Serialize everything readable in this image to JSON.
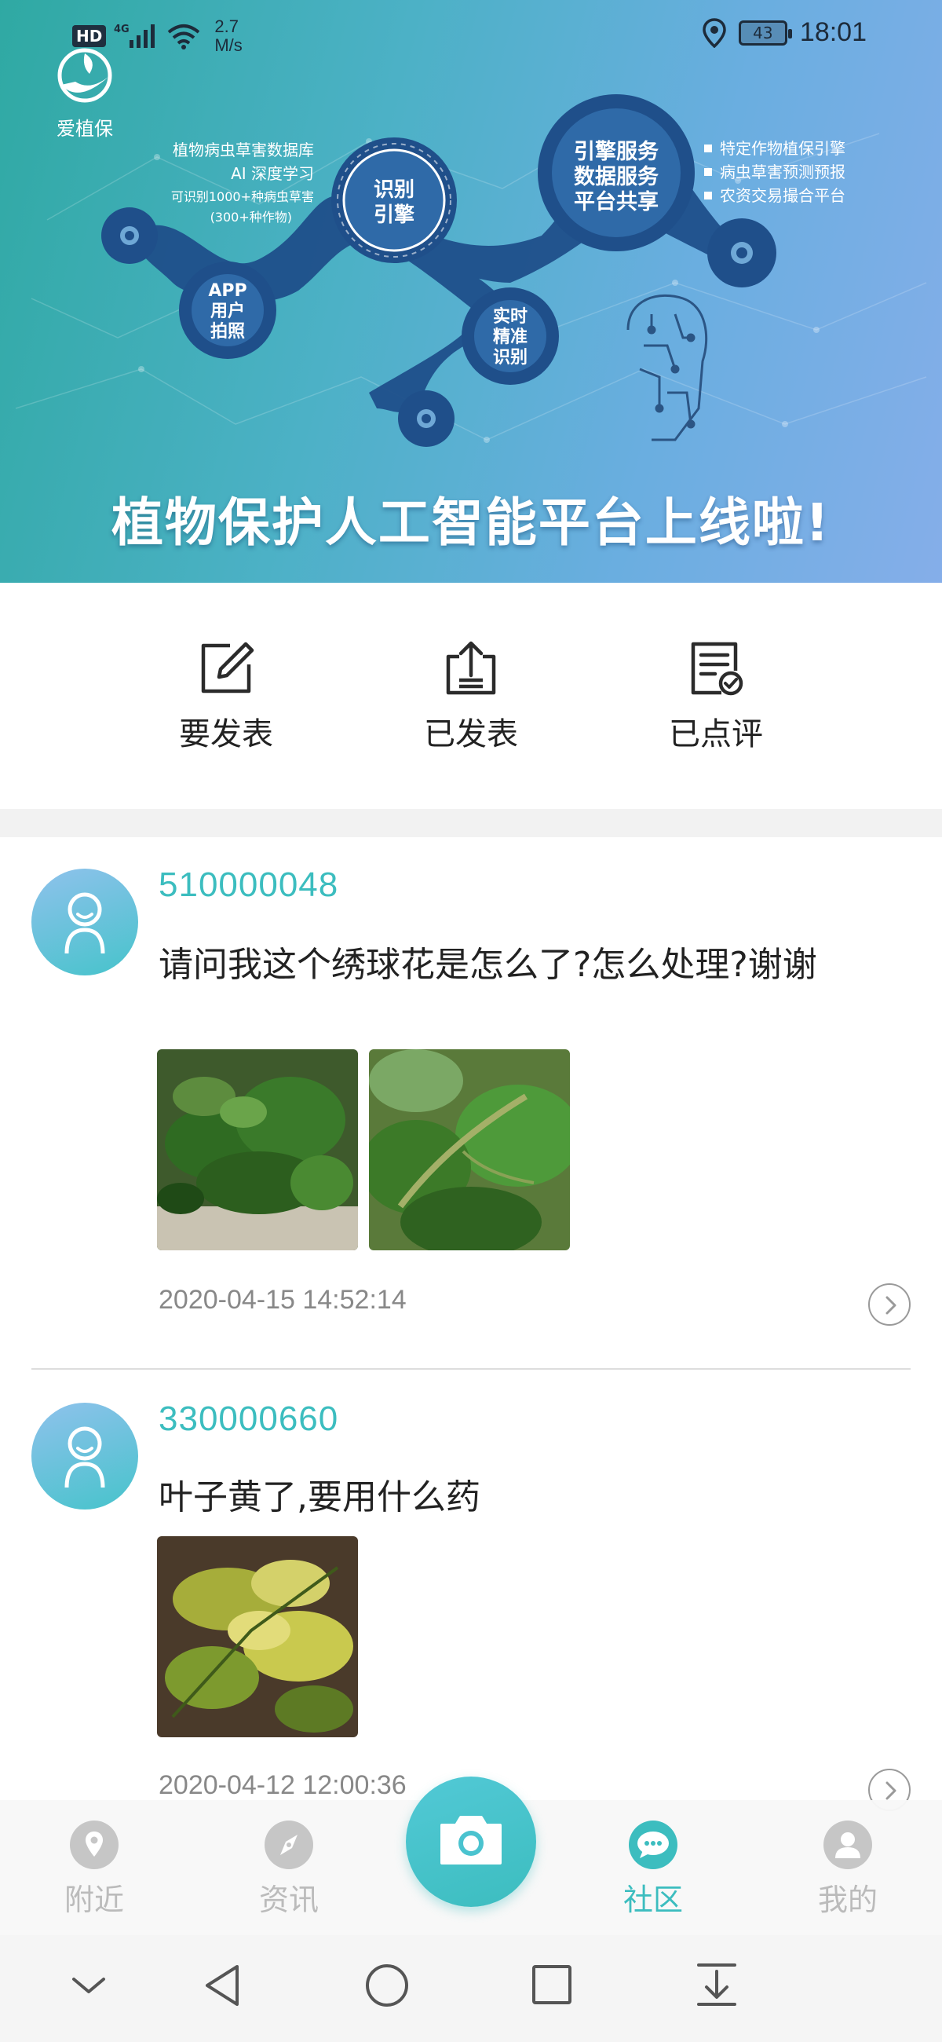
{
  "status_bar": {
    "network": "HD",
    "signal_label": "4G",
    "speed_value": "2.7",
    "speed_unit": "M/s",
    "battery": "43",
    "time": "18:01"
  },
  "brand": {
    "name": "爱植保"
  },
  "hero": {
    "title": "植物保护人工智能平台上线啦!",
    "node_app": [
      "APP",
      "用户",
      "拍照"
    ],
    "node_engine": [
      "识别",
      "引擎"
    ],
    "node_realtime": [
      "实时",
      "精准",
      "识别"
    ],
    "node_services": [
      "引擎服务",
      "数据服务",
      "平台共享"
    ],
    "left_caption": [
      "植物病虫草害数据库",
      "AI 深度学习",
      "可识别1000+种病虫草害",
      "(300+种作物)"
    ],
    "right_caption": [
      "特定作物植保引擎",
      "病虫草害预测预报",
      "农资交易撮合平台"
    ]
  },
  "actions": [
    {
      "label": "要发表",
      "icon": "compose-icon"
    },
    {
      "label": "已发表",
      "icon": "upload-tray-icon"
    },
    {
      "label": "已点评",
      "icon": "reviewed-document-icon"
    }
  ],
  "posts": [
    {
      "user_id": "510000048",
      "text": "请问我这个绣球花是怎么了?怎么处理?谢谢",
      "time": "2020-04-15 14:52:14"
    },
    {
      "user_id": "330000660",
      "text": "叶子黄了,要用什么药",
      "time": "2020-04-12 12:00:36"
    }
  ],
  "bottom_nav": [
    {
      "label": "附近",
      "icon": "location-pin-icon",
      "active": false
    },
    {
      "label": "资讯",
      "icon": "compass-icon",
      "active": false
    },
    {
      "label": "社区",
      "icon": "chat-bubble-icon",
      "active": true
    },
    {
      "label": "我的",
      "icon": "user-icon",
      "active": false
    }
  ],
  "colors": {
    "accent": "#3cbdbf",
    "hero_start": "#2fa9a3",
    "hero_end": "#85aee9",
    "node_dark": "#1f4f8a",
    "inactive_nav": "#c6c6c6"
  }
}
